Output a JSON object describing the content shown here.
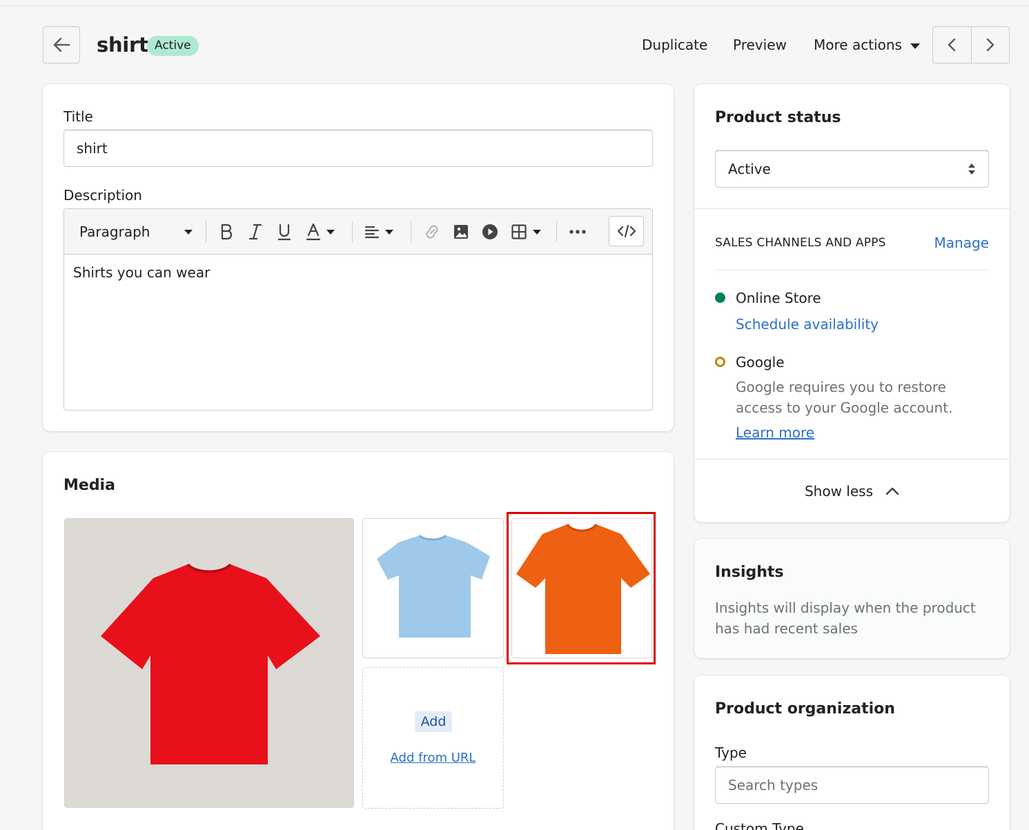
{
  "header": {
    "title": "shirt",
    "status_badge": "Active",
    "actions": {
      "duplicate": "Duplicate",
      "preview": "Preview",
      "more": "More actions"
    }
  },
  "product": {
    "title_label": "Title",
    "title_value": "shirt",
    "description_label": "Description",
    "paragraph_select": "Paragraph",
    "description_text": "Shirts you can wear"
  },
  "media": {
    "title": "Media",
    "images": [
      {
        "alt": "red t-shirt",
        "color": "#e8101a"
      },
      {
        "alt": "light blue t-shirt",
        "color": "#9ec9ea"
      },
      {
        "alt": "orange t-shirt",
        "color": "#ee6012"
      }
    ],
    "add_label": "Add",
    "add_url_label": "Add from URL"
  },
  "status": {
    "title": "Product status",
    "selected": "Active",
    "channels_heading": "SALES CHANNELS AND APPS",
    "manage": "Manage",
    "online_store": "Online Store",
    "schedule": "Schedule availability",
    "google": "Google",
    "google_desc_1": "Google requires you to restore",
    "google_desc_2": "access to your Google account.",
    "learn_more": "Learn more",
    "show_less": "Show less"
  },
  "insights": {
    "title": "Insights",
    "line1": "Insights will display when the product",
    "line2": "has had recent sales"
  },
  "organization": {
    "title": "Product organization",
    "type_label": "Type",
    "type_placeholder": "Search types",
    "custom_type_label": "Custom Type"
  },
  "colors": {
    "accent": "#2c6ecb",
    "active_badge": "#aee9d1",
    "online_dot": "#007f5f",
    "google_ring": "#b98900",
    "highlight": "#e00000"
  }
}
